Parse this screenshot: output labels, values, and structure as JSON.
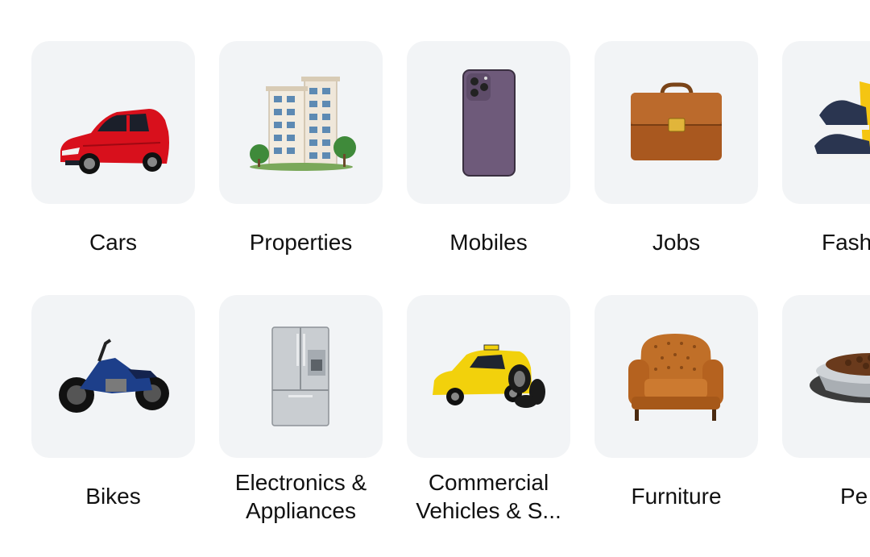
{
  "categories_row1": [
    {
      "key": "cars",
      "label": "Cars",
      "icon": "red-car-icon"
    },
    {
      "key": "properties",
      "label": "Properties",
      "icon": "building-icon"
    },
    {
      "key": "mobiles",
      "label": "Mobiles",
      "icon": "phone-icon"
    },
    {
      "key": "jobs",
      "label": "Jobs",
      "icon": "briefcase-icon"
    },
    {
      "key": "fashion",
      "label": "Fash",
      "icon": "shoes-icon"
    }
  ],
  "categories_row2": [
    {
      "key": "bikes",
      "label": "Bikes",
      "icon": "motorcycle-icon"
    },
    {
      "key": "electronics",
      "label_line1": "Electronics &",
      "label_line2": "Appliances",
      "icon": "refrigerator-icon"
    },
    {
      "key": "commercial",
      "label_line1": "Commercial",
      "label_line2": "Vehicles & S...",
      "icon": "taxi-icon"
    },
    {
      "key": "furniture",
      "label": "Furniture",
      "icon": "armchair-icon"
    },
    {
      "key": "pets",
      "label": "Pe",
      "icon": "pet-bowl-icon"
    }
  ],
  "colors": {
    "card_bg": "#f2f4f6",
    "text": "#111111",
    "page_bg": "#ffffff"
  }
}
